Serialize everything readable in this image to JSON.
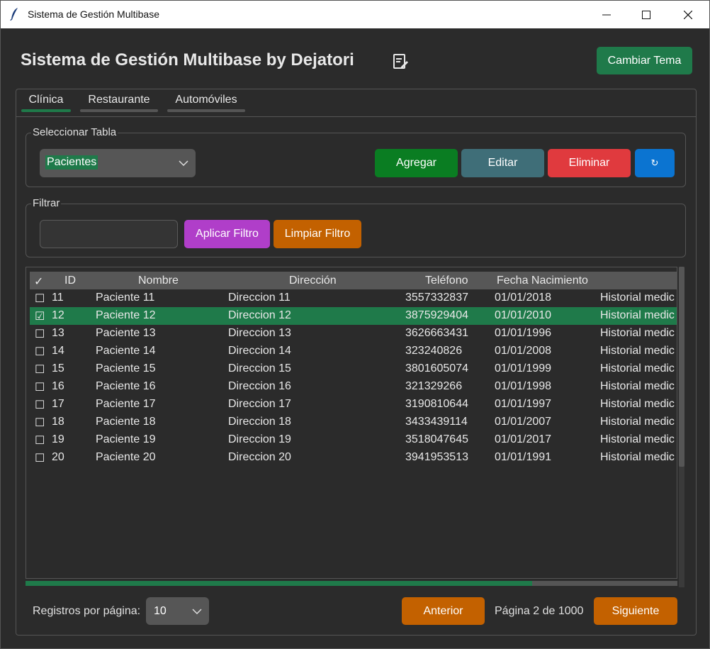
{
  "window": {
    "title": "Sistema de Gestión Multibase"
  },
  "header": {
    "title": "Sistema de Gestión Multibase by Dejatori",
    "theme_button": "Cambiar Tema"
  },
  "tabs": [
    {
      "label": "Clínica",
      "active": true
    },
    {
      "label": "Restaurante",
      "active": false
    },
    {
      "label": "Automóviles",
      "active": false
    }
  ],
  "table_select": {
    "group_label": "Seleccionar Tabla",
    "selected": "Pacientes",
    "buttons": {
      "add": "Agregar",
      "edit": "Editar",
      "delete": "Eliminar",
      "refresh": "↻"
    }
  },
  "filter": {
    "group_label": "Filtrar",
    "value": "",
    "apply": "Aplicar Filtro",
    "clear": "Limpiar Filtro"
  },
  "table": {
    "columns": [
      "✓",
      "ID",
      "Nombre",
      "Dirección",
      "Teléfono",
      "Fecha Nacimiento",
      ""
    ],
    "rows": [
      {
        "check": "☐",
        "id": "11",
        "nombre": "Paciente 11",
        "direccion": "Direccion 11",
        "telefono": "3557332837",
        "fecha": "01/01/2018",
        "historial": "Historial medic"
      },
      {
        "check": "☑",
        "id": "12",
        "nombre": "Paciente 12",
        "direccion": "Direccion 12",
        "telefono": "3875929404",
        "fecha": "01/01/2010",
        "historial": "Historial medic"
      },
      {
        "check": "☐",
        "id": "13",
        "nombre": "Paciente 13",
        "direccion": "Direccion 13",
        "telefono": "3626663431",
        "fecha": "01/01/1996",
        "historial": "Historial medic"
      },
      {
        "check": "☐",
        "id": "14",
        "nombre": "Paciente 14",
        "direccion": "Direccion 14",
        "telefono": "323240826",
        "fecha": "01/01/2008",
        "historial": "Historial medic"
      },
      {
        "check": "☐",
        "id": "15",
        "nombre": "Paciente 15",
        "direccion": "Direccion 15",
        "telefono": "3801605074",
        "fecha": "01/01/1999",
        "historial": "Historial medic"
      },
      {
        "check": "☐",
        "id": "16",
        "nombre": "Paciente 16",
        "direccion": "Direccion 16",
        "telefono": "321329266",
        "fecha": "01/01/1998",
        "historial": "Historial medic"
      },
      {
        "check": "☐",
        "id": "17",
        "nombre": "Paciente 17",
        "direccion": "Direccion 17",
        "telefono": "3190810644",
        "fecha": "01/01/1997",
        "historial": "Historial medic"
      },
      {
        "check": "☐",
        "id": "18",
        "nombre": "Paciente 18",
        "direccion": "Direccion 18",
        "telefono": "3433439114",
        "fecha": "01/01/2007",
        "historial": "Historial medic"
      },
      {
        "check": "☐",
        "id": "19",
        "nombre": "Paciente 19",
        "direccion": "Direccion 19",
        "telefono": "3518047645",
        "fecha": "01/01/2017",
        "historial": "Historial medic"
      },
      {
        "check": "☐",
        "id": "20",
        "nombre": "Paciente 20",
        "direccion": "Direccion 20",
        "telefono": "3941953513",
        "fecha": "01/01/1991",
        "historial": "Historial medic"
      }
    ],
    "selected_row": 1
  },
  "pagination": {
    "per_page_label": "Registros por página:",
    "per_page": "10",
    "prev": "Anterior",
    "page_text": "Página 2 de 1000",
    "next": "Siguiente"
  },
  "colors": {
    "background": "#2b2b2b",
    "accent_green": "#1f7a4a",
    "add_green": "#0a7d22",
    "edit_slate": "#3f6e78",
    "delete_red": "#e03a3e",
    "refresh_blue": "#0b74d1",
    "apply_purple": "#b03ec9",
    "orange": "#c36100"
  }
}
